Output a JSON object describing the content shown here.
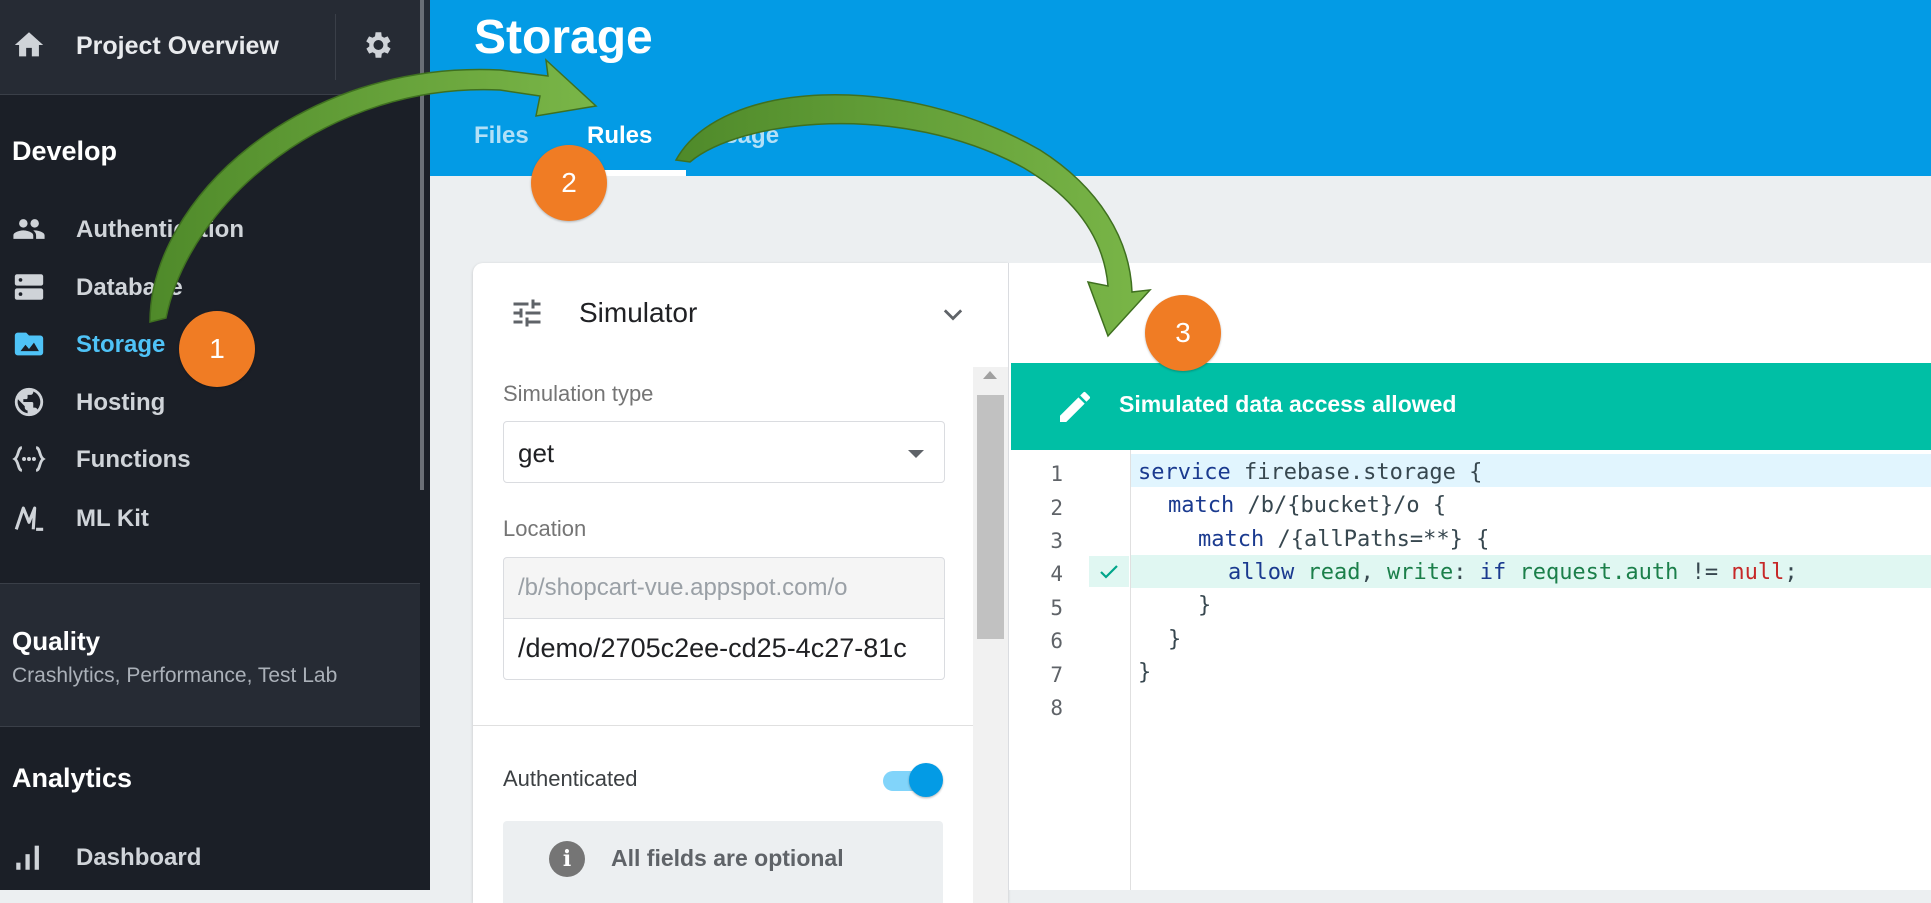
{
  "sidebar": {
    "project_title": "Project Overview",
    "sections": {
      "develop": "Develop",
      "quality": "Quality",
      "quality_sub": "Crashlytics, Performance, Test Lab",
      "analytics": "Analytics"
    },
    "items": [
      {
        "label": "Authentication",
        "icon": "people-icon"
      },
      {
        "label": "Database",
        "icon": "database-icon"
      },
      {
        "label": "Storage",
        "icon": "storage-icon",
        "active": true
      },
      {
        "label": "Hosting",
        "icon": "globe-icon"
      },
      {
        "label": "Functions",
        "icon": "functions-icon"
      },
      {
        "label": "ML Kit",
        "icon": "ml-kit-icon"
      },
      {
        "label": "Dashboard",
        "icon": "bar-chart-icon"
      }
    ]
  },
  "header": {
    "title": "Storage",
    "tabs": [
      {
        "label": "Files"
      },
      {
        "label": "Rules",
        "active": true
      },
      {
        "label": "Usage"
      }
    ]
  },
  "simulator": {
    "title": "Simulator",
    "simulation_type_label": "Simulation type",
    "simulation_type_value": "get",
    "location_label": "Location",
    "location_base": "/b/shopcart-vue.appspot.com/o",
    "location_path": "/demo/2705c2ee-cd25-4c27-81c",
    "authenticated_label": "Authenticated",
    "authenticated": true,
    "info_text": "All fields are optional"
  },
  "editor": {
    "banner": "Simulated data access allowed",
    "line_numbers": [
      "1",
      "2",
      "3",
      "4",
      "5",
      "6",
      "7",
      "8"
    ],
    "code": {
      "l1_kw": "service",
      "l1_rest": " firebase.storage {",
      "l2_kw": "match",
      "l2_rest": " /b/{bucket}/o {",
      "l3_kw": "match",
      "l3_rest": " /{allPaths=**} {",
      "l4_allow": "allow",
      "l4_read": "read",
      "l4_comma": ", ",
      "l4_write": "write",
      "l4_colon": ": ",
      "l4_if": "if",
      "l4_req": "request.auth",
      "l4_op": " != ",
      "l4_null": "null",
      "l4_semi": ";",
      "l5": "}",
      "l6": "}",
      "l7": "}"
    }
  },
  "steps": [
    "1",
    "2",
    "3"
  ],
  "colors": {
    "sidebar_bg": "#1b1f27",
    "header_bg": "#039be5",
    "banner_bg": "#00bfa5",
    "badge": "#f07c24",
    "arrow": "#6aa33a",
    "active_nav": "#4fc3f7"
  }
}
